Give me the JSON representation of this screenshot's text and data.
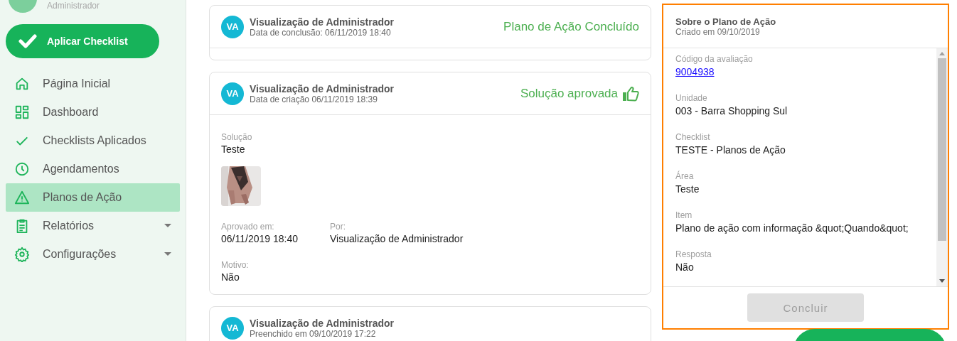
{
  "sidebar": {
    "user_role": "Administrador",
    "apply_button": "Aplicar Checklist",
    "items": [
      {
        "label": "Página Inicial",
        "selected": false,
        "has_submenu": false
      },
      {
        "label": "Dashboard",
        "selected": false,
        "has_submenu": false
      },
      {
        "label": "Checklists Aplicados",
        "selected": false,
        "has_submenu": false
      },
      {
        "label": "Agendamentos",
        "selected": false,
        "has_submenu": false
      },
      {
        "label": "Planos de Ação",
        "selected": true,
        "has_submenu": false
      },
      {
        "label": "Relatórios",
        "selected": false,
        "has_submenu": true
      },
      {
        "label": "Configurações",
        "selected": false,
        "has_submenu": true
      }
    ]
  },
  "timeline": [
    {
      "avatar": "VA",
      "author": "Visualização de Administrador",
      "date": "Data de conclusão: 06/11/2019 18:40",
      "status": "Plano de Ação Concluído",
      "kind": "completed"
    },
    {
      "avatar": "VA",
      "author": "Visualização de Administrador",
      "date": "Data de criação 06/11/2019 18:39",
      "status": "Solução aprovada",
      "kind": "approved",
      "solution_label": "Solução",
      "solution": "Teste",
      "photo": {
        "kind": "picture"
      },
      "fields": [
        {
          "label": "Aprovado em:",
          "value": "06/11/2019 18:40"
        },
        {
          "label": "Por:",
          "value": "Visualização de Administrador"
        }
      ],
      "reason_label": "Motivo:",
      "reason": "Não"
    },
    {
      "avatar": "VA",
      "author": "Visualização de Administrador",
      "date": "Preenchido em 09/10/2019 17:22",
      "kind": "filled"
    }
  ],
  "panel": {
    "title": "Sobre o Plano de Ação",
    "subtitle": "Criado em 09/10/2019",
    "fields": [
      {
        "label": "Código da avaliação",
        "value": "9004938",
        "kind": "link"
      },
      {
        "label": "Unidade",
        "value": "003 - Barra Shopping Sul",
        "kind": "text"
      },
      {
        "label": "Checklist",
        "value": "TESTE - Planos de Ação",
        "kind": "text"
      },
      {
        "label": "Área",
        "value": "Teste",
        "kind": "text"
      },
      {
        "label": "Item",
        "value": "Plano de ação com informação &quot;Quando&quot;",
        "kind": "text"
      },
      {
        "label": "Resposta",
        "value": "Não",
        "kind": "text"
      }
    ],
    "button": {
      "label": "Concluir",
      "disabled": true
    }
  }
}
